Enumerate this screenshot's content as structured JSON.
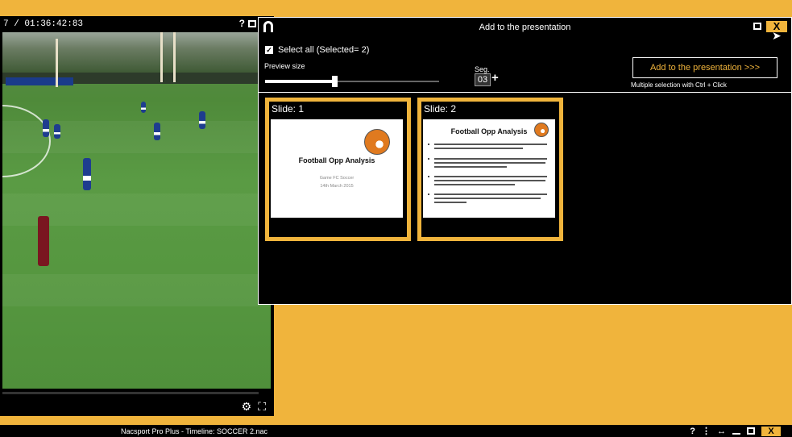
{
  "video": {
    "timecode": "7 / 01:36:42:83",
    "help_glyph": "?",
    "settings_glyph": "⚙",
    "fullscreen_glyph": "⛶"
  },
  "dialog": {
    "title": "Add to the presentation",
    "close_glyph": "X",
    "select_all_label": "Select all (Selected= 2)",
    "preview_size_label": "Preview size",
    "preview_size_level": 0.4,
    "seg_label": "Seg.",
    "seg_value": "03",
    "seg_plus": "+",
    "add_button_label": "Add to the presentation >>>",
    "multi_hint": "Multiple selection with Ctrl + Click",
    "slides": [
      {
        "label": "Slide: 1",
        "title": "Football Opp Analysis",
        "subtitle": "Game FC Soccer",
        "date": "14th March 2015"
      },
      {
        "label": "Slide: 2",
        "title": "Football Opp Analysis"
      }
    ]
  },
  "statusbar": {
    "title": "Nacsport Pro Plus - Timeline: SOCCER 2.nac",
    "help_glyph": "?",
    "pin_glyph": "⋮",
    "arrows_glyph": "↔",
    "close_glyph": "X"
  },
  "colors": {
    "accent": "#f0b43c",
    "panel": "#000000"
  }
}
